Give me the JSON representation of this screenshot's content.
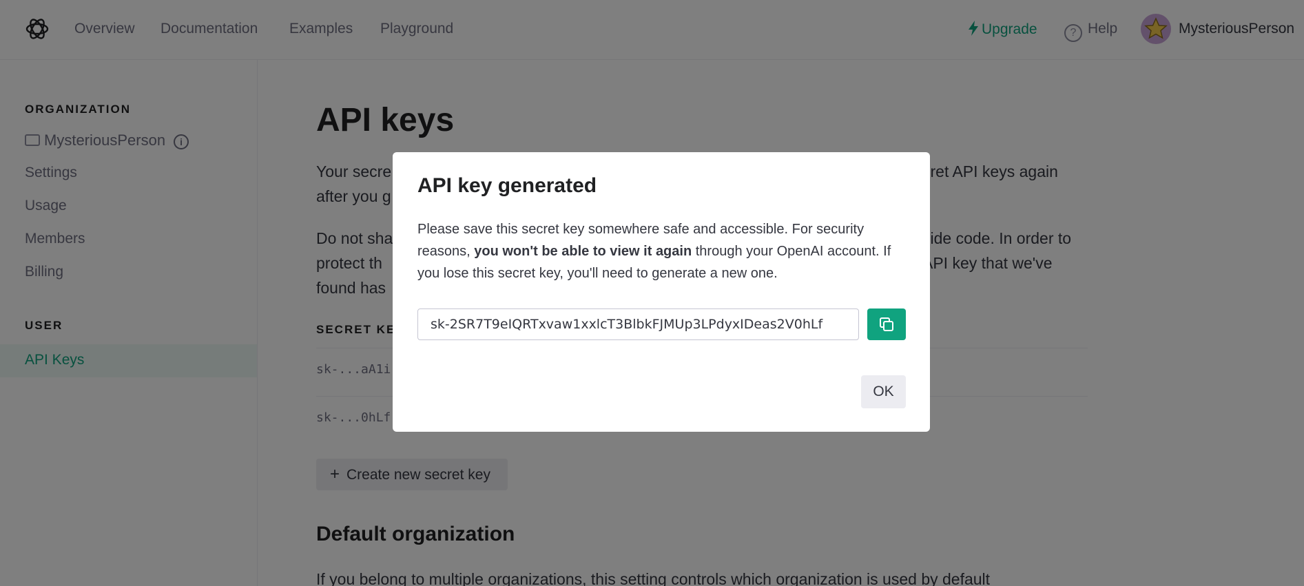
{
  "nav": {
    "links": [
      "Overview",
      "Documentation",
      "Examples",
      "Playground"
    ],
    "upgrade": "Upgrade",
    "help": "Help",
    "username": "MysteriousPerson",
    "accent_color": "#10a37f"
  },
  "sidebar": {
    "org_heading": "ORGANIZATION",
    "org_name": "MysteriousPerson",
    "org_items": [
      "Settings",
      "Usage",
      "Members",
      "Billing"
    ],
    "user_heading": "USER",
    "active_item": "API Keys"
  },
  "main": {
    "title": "API keys",
    "para1_a": "Your secre",
    "para1_b": "cret API keys again",
    "para1_c": "after you g",
    "para2_a": "Do not sha",
    "para2_b": "side code. In order to",
    "para2_c": "protect th",
    "para2_d": "API key that we've",
    "para2_e": "found has",
    "table_heading": "SECRET KE",
    "keys": [
      "sk-...aA1i",
      "sk-...0hLf"
    ],
    "create_button": "Create new secret key",
    "section_title": "Default organization",
    "section_text": "If you belong to multiple organizations, this setting controls which organization is used by default"
  },
  "modal": {
    "title": "API key generated",
    "text_1": "Please save this secret key somewhere safe and accessible. For security reasons, ",
    "text_bold": "you won't be able to view it again",
    "text_2": " through your OpenAI account. If you lose this secret key, you'll need to generate a new one.",
    "secret_key": "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",
    "ok_button": "OK"
  }
}
